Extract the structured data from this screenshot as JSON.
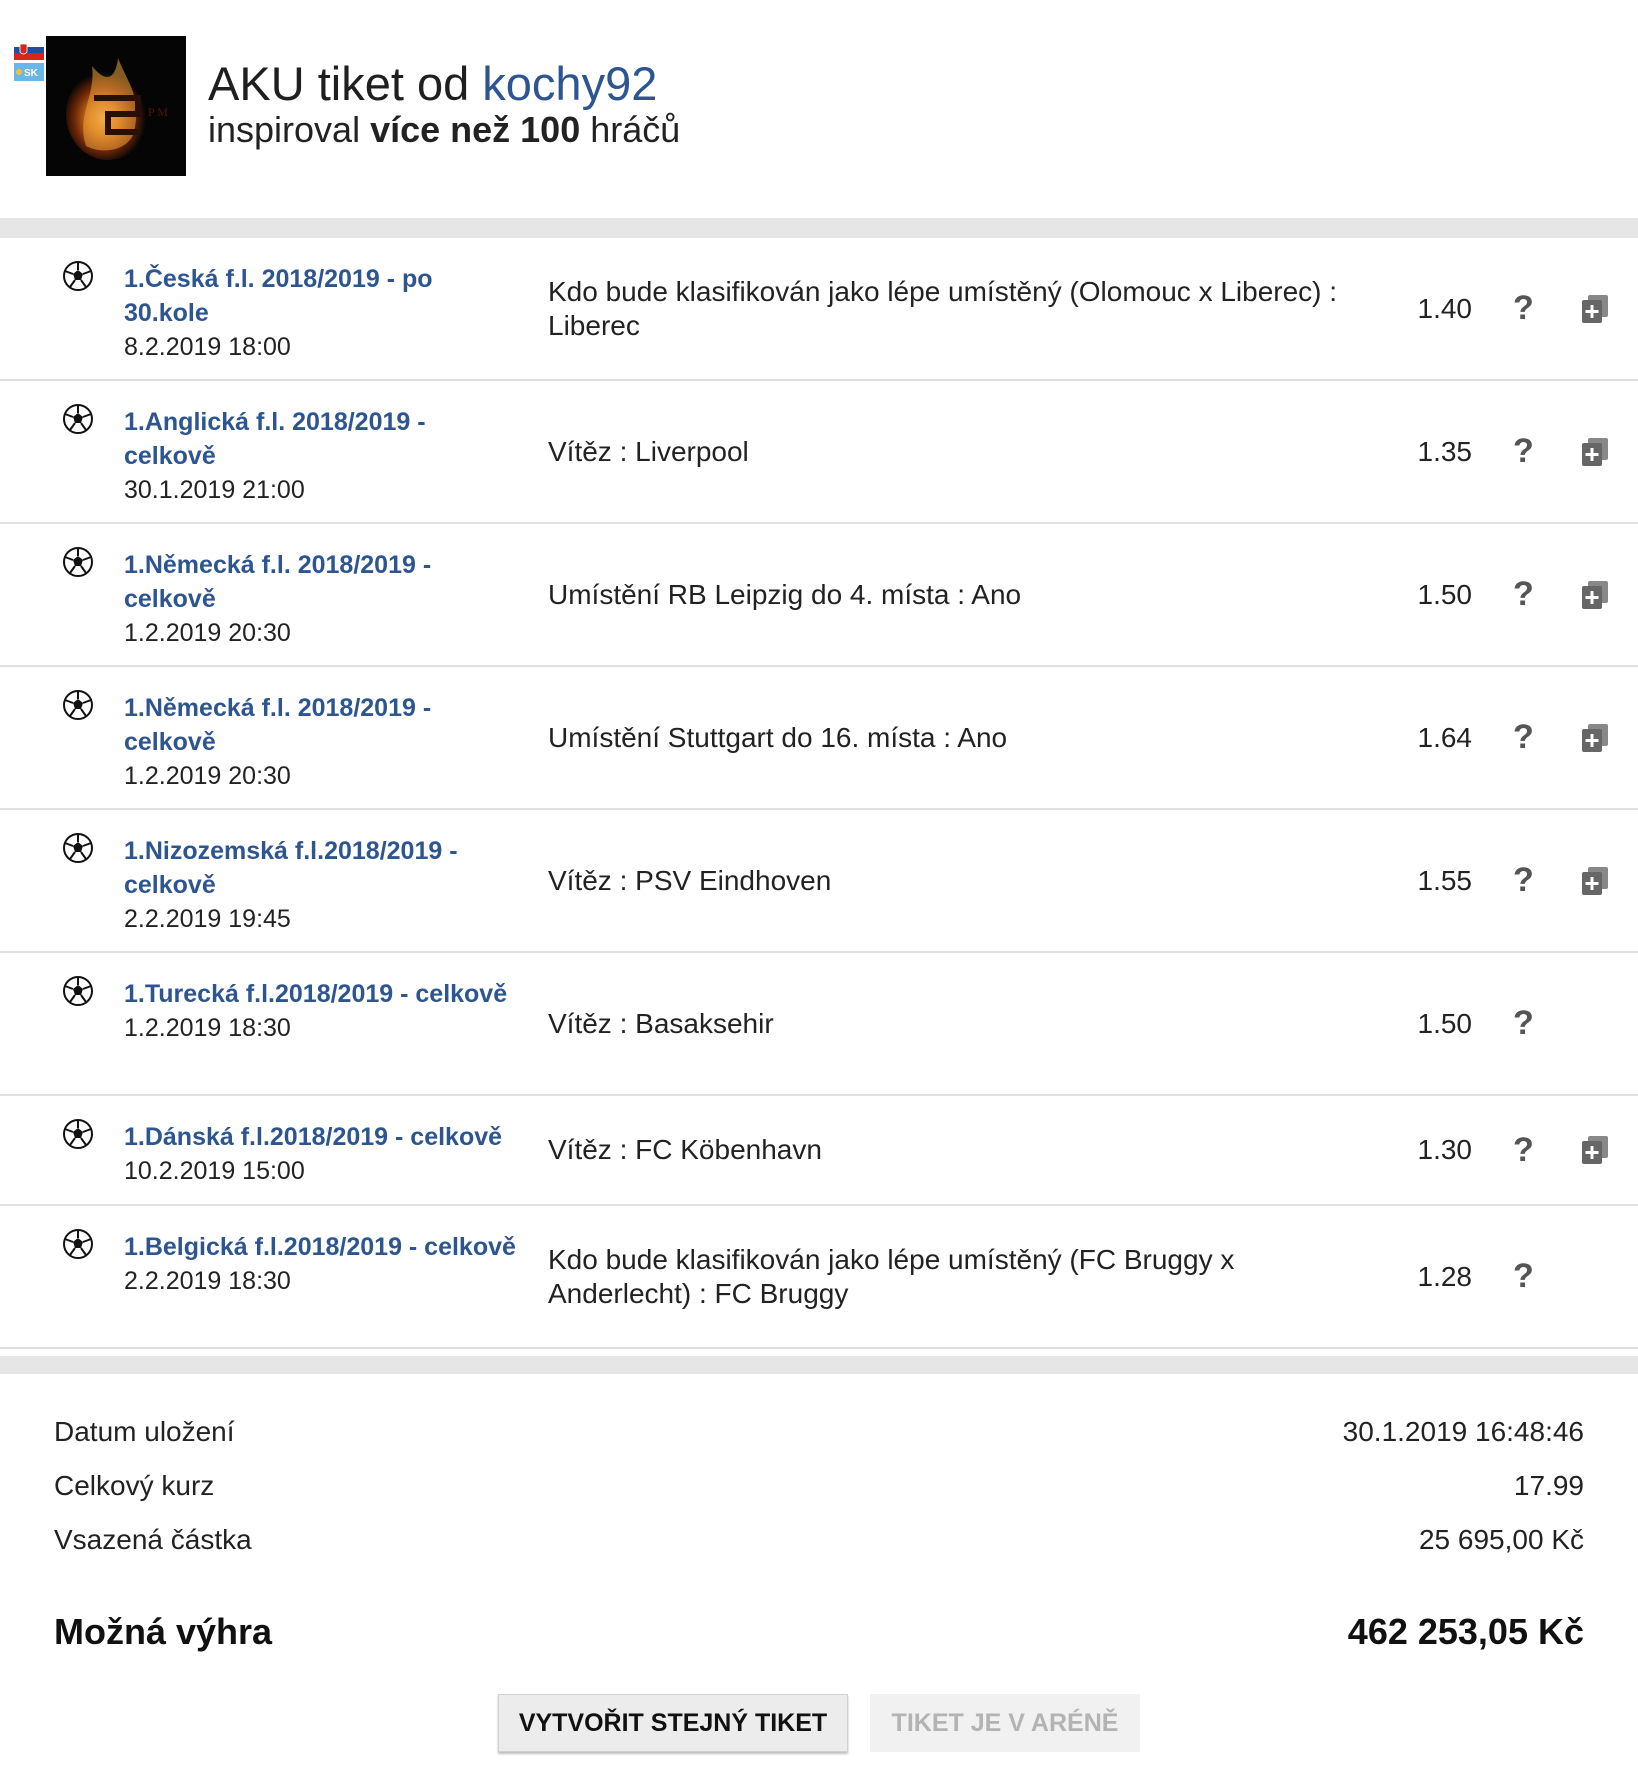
{
  "header": {
    "title_prefix": "AKU tiket od ",
    "username": "kochy92",
    "subtitle_prefix": "inspiroval ",
    "subtitle_bold": "více než 100",
    "subtitle_suffix": " hráčů",
    "flag_label": "SK"
  },
  "bets": [
    {
      "league": "1.Česká f.l. 2018/2019 - po 30.kole",
      "date": "8.2.2019 18:00",
      "bet": "Kdo bude klasifikován jako lépe umístěný (Olomouc x Liberec) : Liberec",
      "odd": "1.40",
      "has_plus": true
    },
    {
      "league": "1.Anglická f.l. 2018/2019 - celkově",
      "date": "30.1.2019 21:00",
      "bet": "Vítěz : Liverpool",
      "odd": "1.35",
      "has_plus": true
    },
    {
      "league": "1.Německá f.l. 2018/2019 - celkově",
      "date": "1.2.2019 20:30",
      "bet": "Umístění RB Leipzig do 4. místa : Ano",
      "odd": "1.50",
      "has_plus": true
    },
    {
      "league": "1.Německá f.l. 2018/2019 - celkově",
      "date": "1.2.2019 20:30",
      "bet": "Umístění Stuttgart do 16. místa : Ano",
      "odd": "1.64",
      "has_plus": true
    },
    {
      "league": "1.Nizozemská f.l.2018/2019 - celkově",
      "date": "2.2.2019 19:45",
      "bet": "Vítěz : PSV Eindhoven",
      "odd": "1.55",
      "has_plus": true
    },
    {
      "league": "1.Turecká f.l.2018/2019 - celkově",
      "date": "1.2.2019 18:30",
      "bet": "Vítěz : Basaksehir",
      "odd": "1.50",
      "has_plus": false
    },
    {
      "league": "1.Dánská f.l.2018/2019 - celkově",
      "date": "10.2.2019 15:00",
      "bet": "Vítěz : FC Köbenhavn",
      "odd": "1.30",
      "has_plus": true
    },
    {
      "league": "1.Belgická f.l.2018/2019 - celkově",
      "date": "2.2.2019 18:30",
      "bet": "Kdo bude klasifikován jako lépe umístěný (FC Bruggy x Anderlecht) : FC Bruggy",
      "odd": "1.28",
      "has_plus": false
    }
  ],
  "bet_help_symbol": "?",
  "summary": {
    "saved_label": "Datum uložení",
    "saved_value": "30.1.2019 16:48:46",
    "total_odds_label": "Celkový kurz",
    "total_odds_value": "17.99",
    "stake_label": "Vsazená částka",
    "stake_value": "25 695,00 Kč",
    "win_label": "Možná výhra",
    "win_value": "462 253,05 Kč"
  },
  "buttons": {
    "create_same": "VYTVOŘIT STEJNÝ TIKET",
    "in_arena": "TIKET JE V ARÉNĚ"
  },
  "colors": {
    "link": "#2d5592",
    "separator": "#e6e6e6"
  }
}
